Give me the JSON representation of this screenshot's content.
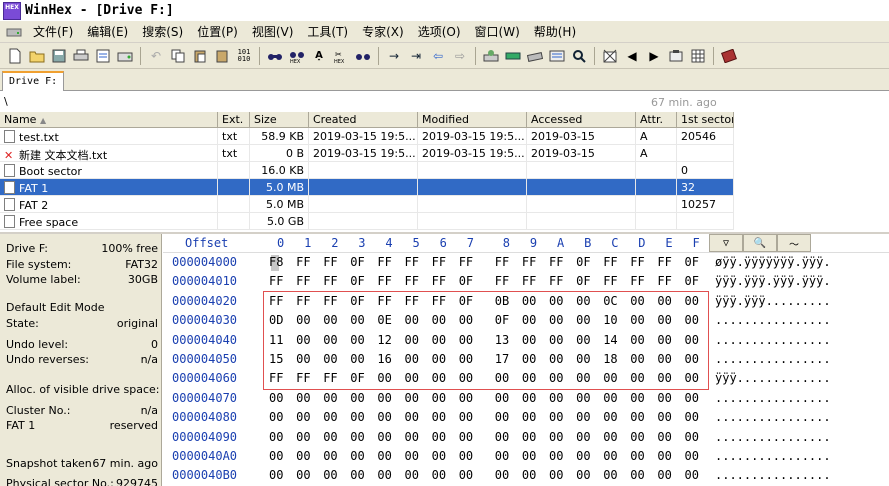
{
  "window": {
    "logo_text": "HEX",
    "title": "WinHex - [Drive F:]"
  },
  "menu": [
    {
      "label": "文件(F)"
    },
    {
      "label": "编辑(E)"
    },
    {
      "label": "搜索(S)"
    },
    {
      "label": "位置(P)"
    },
    {
      "label": "视图(V)"
    },
    {
      "label": "工具(T)"
    },
    {
      "label": "专家(X)"
    },
    {
      "label": "选项(O)"
    },
    {
      "label": "窗口(W)"
    },
    {
      "label": "帮助(H)"
    }
  ],
  "toolbar": {
    "icons": [
      "new-icon",
      "open-icon",
      "save-icon",
      "print-icon",
      "properties-icon",
      "open-disk-icon",
      "undo-icon",
      "copy-icon",
      "paste-icon",
      "clipboard-icon",
      "binary-icon",
      "find-text-icon",
      "find-hex-icon",
      "replace-text-icon",
      "replace-hex-icon",
      "find-again-icon",
      "goto-offset-icon",
      "goto-sector-icon",
      "back-icon",
      "forward-icon",
      "disk-tool-icon",
      "ram-icon",
      "drive-icon",
      "calc-icon",
      "search-icon",
      "file-manager-icon",
      "prev-icon",
      "next-icon",
      "disk-icon",
      "table-icon",
      "book-icon"
    ]
  },
  "tab": {
    "label": "Drive F:"
  },
  "path": {
    "current": "\\",
    "status": "67 min. ago"
  },
  "file_list": {
    "columns": [
      "Name",
      "Ext.",
      "Size",
      "Created",
      "Modified",
      "Accessed",
      "Attr.",
      "1st sector"
    ],
    "rows": [
      {
        "name": "test.txt",
        "ext": "txt",
        "size": "58.9 KB",
        "created": "2019-03-15  19:5...",
        "modified": "2019-03-15  19:5...",
        "accessed": "2019-03-15",
        "attr": "A",
        "sector": "20546",
        "icon": "file-icon",
        "selected": false
      },
      {
        "name": "新建 文本文档.txt",
        "ext": "txt",
        "size": "0 B",
        "created": "2019-03-15  19:5...",
        "modified": "2019-03-15  19:5...",
        "accessed": "2019-03-15",
        "attr": "A",
        "sector": "",
        "icon": "deleted-file-icon",
        "selected": false
      },
      {
        "name": "Boot sector",
        "ext": "",
        "size": "16.0 KB",
        "created": "",
        "modified": "",
        "accessed": "",
        "attr": "",
        "sector": "0",
        "icon": "file-icon",
        "selected": false
      },
      {
        "name": "FAT 1",
        "ext": "",
        "size": "5.0 MB",
        "created": "",
        "modified": "",
        "accessed": "",
        "attr": "",
        "sector": "32",
        "icon": "file-icon",
        "selected": true
      },
      {
        "name": "FAT 2",
        "ext": "",
        "size": "5.0 MB",
        "created": "",
        "modified": "",
        "accessed": "",
        "attr": "",
        "sector": "10257",
        "icon": "file-icon",
        "selected": false
      },
      {
        "name": "Free space",
        "ext": "",
        "size": "5.0 GB",
        "created": "",
        "modified": "",
        "accessed": "",
        "attr": "",
        "sector": "",
        "icon": "file-icon",
        "selected": false
      }
    ]
  },
  "info": [
    {
      "label": "Drive F:",
      "value": "100% free"
    },
    {
      "label": "File system:",
      "value": "FAT32"
    },
    {
      "label": "Volume label:",
      "value": "30GB"
    },
    {
      "label": "",
      "value": ""
    },
    {
      "label": "Default Edit Mode",
      "value": ""
    },
    {
      "label": "State:",
      "value": "original"
    },
    {
      "label": "",
      "value": ""
    },
    {
      "label": "Undo level:",
      "value": "0"
    },
    {
      "label": "Undo reverses:",
      "value": "n/a"
    },
    {
      "label": "",
      "value": ""
    },
    {
      "label": "Alloc. of visible drive space:",
      "value": ""
    },
    {
      "label": "",
      "value": ""
    },
    {
      "label": "Cluster No.:",
      "value": "n/a"
    },
    {
      "label": "FAT 1",
      "value": "reserved"
    },
    {
      "label": "",
      "value": ""
    },
    {
      "label": "",
      "value": ""
    },
    {
      "label": "Snapshot taken",
      "value": "67 min. ago"
    },
    {
      "label": "",
      "value": ""
    },
    {
      "label": "Physical sector No.:",
      "value": "929745"
    }
  ],
  "hex": {
    "offset_label": "Offset",
    "columns": [
      "0",
      "1",
      "2",
      "3",
      "4",
      "5",
      "6",
      "7",
      "8",
      "9",
      "A",
      "B",
      "C",
      "D",
      "E",
      "F"
    ],
    "rows": [
      {
        "offset": "000004000",
        "bytes": [
          "F8",
          "FF",
          "FF",
          "0F",
          "FF",
          "FF",
          "FF",
          "FF",
          "FF",
          "FF",
          "FF",
          "0F",
          "FF",
          "FF",
          "FF",
          "0F"
        ],
        "ascii": "øÿÿ.ÿÿÿÿÿÿÿ.ÿÿÿ."
      },
      {
        "offset": "000004010",
        "bytes": [
          "FF",
          "FF",
          "FF",
          "0F",
          "FF",
          "FF",
          "FF",
          "0F",
          "FF",
          "FF",
          "FF",
          "0F",
          "FF",
          "FF",
          "FF",
          "0F"
        ],
        "ascii": "ÿÿÿ.ÿÿÿ.ÿÿÿ.ÿÿÿ."
      },
      {
        "offset": "000004020",
        "bytes": [
          "FF",
          "FF",
          "FF",
          "0F",
          "FF",
          "FF",
          "FF",
          "0F",
          "0B",
          "00",
          "00",
          "00",
          "0C",
          "00",
          "00",
          "00"
        ],
        "ascii": "ÿÿÿ.ÿÿÿ........."
      },
      {
        "offset": "000004030",
        "bytes": [
          "0D",
          "00",
          "00",
          "00",
          "0E",
          "00",
          "00",
          "00",
          "0F",
          "00",
          "00",
          "00",
          "10",
          "00",
          "00",
          "00"
        ],
        "ascii": "................"
      },
      {
        "offset": "000004040",
        "bytes": [
          "11",
          "00",
          "00",
          "00",
          "12",
          "00",
          "00",
          "00",
          "13",
          "00",
          "00",
          "00",
          "14",
          "00",
          "00",
          "00"
        ],
        "ascii": "................"
      },
      {
        "offset": "000004050",
        "bytes": [
          "15",
          "00",
          "00",
          "00",
          "16",
          "00",
          "00",
          "00",
          "17",
          "00",
          "00",
          "00",
          "18",
          "00",
          "00",
          "00"
        ],
        "ascii": "................"
      },
      {
        "offset": "000004060",
        "bytes": [
          "FF",
          "FF",
          "FF",
          "0F",
          "00",
          "00",
          "00",
          "00",
          "00",
          "00",
          "00",
          "00",
          "00",
          "00",
          "00",
          "00"
        ],
        "ascii": "ÿÿÿ............."
      },
      {
        "offset": "000004070",
        "bytes": [
          "00",
          "00",
          "00",
          "00",
          "00",
          "00",
          "00",
          "00",
          "00",
          "00",
          "00",
          "00",
          "00",
          "00",
          "00",
          "00"
        ],
        "ascii": "................"
      },
      {
        "offset": "000004080",
        "bytes": [
          "00",
          "00",
          "00",
          "00",
          "00",
          "00",
          "00",
          "00",
          "00",
          "00",
          "00",
          "00",
          "00",
          "00",
          "00",
          "00"
        ],
        "ascii": "................"
      },
      {
        "offset": "000004090",
        "bytes": [
          "00",
          "00",
          "00",
          "00",
          "00",
          "00",
          "00",
          "00",
          "00",
          "00",
          "00",
          "00",
          "00",
          "00",
          "00",
          "00"
        ],
        "ascii": "................"
      },
      {
        "offset": "0000040A0",
        "bytes": [
          "00",
          "00",
          "00",
          "00",
          "00",
          "00",
          "00",
          "00",
          "00",
          "00",
          "00",
          "00",
          "00",
          "00",
          "00",
          "00"
        ],
        "ascii": "................"
      },
      {
        "offset": "0000040B0",
        "bytes": [
          "00",
          "00",
          "00",
          "00",
          "00",
          "00",
          "00",
          "00",
          "00",
          "00",
          "00",
          "00",
          "00",
          "00",
          "00",
          "00"
        ],
        "ascii": "................"
      }
    ]
  }
}
